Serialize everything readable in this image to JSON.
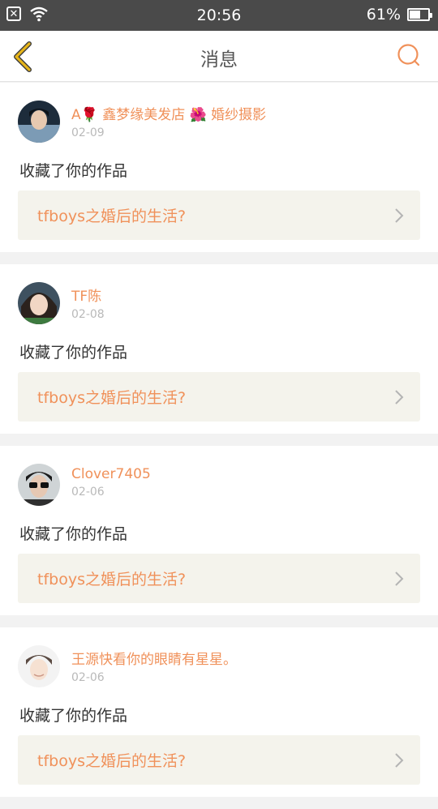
{
  "status_bar": {
    "time": "20:56",
    "battery": "61%",
    "battery_level": 0.61
  },
  "nav": {
    "title": "消息"
  },
  "messages": [
    {
      "user_name": "A🌹 鑫梦缘美发店 🌺 婚纱摄影",
      "date": "02-09",
      "action": "收藏了你的作品",
      "work_title": "tfboys之婚后的生活?"
    },
    {
      "user_name": "TF陈",
      "date": "02-08",
      "action": "收藏了你的作品",
      "work_title": "tfboys之婚后的生活?"
    },
    {
      "user_name": "Clover7405",
      "date": "02-06",
      "action": "收藏了你的作品",
      "work_title": "tfboys之婚后的生活?"
    },
    {
      "user_name": "王源快看你的眼睛有星星。",
      "date": "02-06",
      "action": "收藏了你的作品",
      "work_title": "tfboys之婚后的生活?"
    }
  ],
  "colors": {
    "accent": "#f0915a",
    "back_arrow": "#e7b51a",
    "card_link_bg": "#f4f3ec",
    "status_bar": "#4a4a4a"
  }
}
